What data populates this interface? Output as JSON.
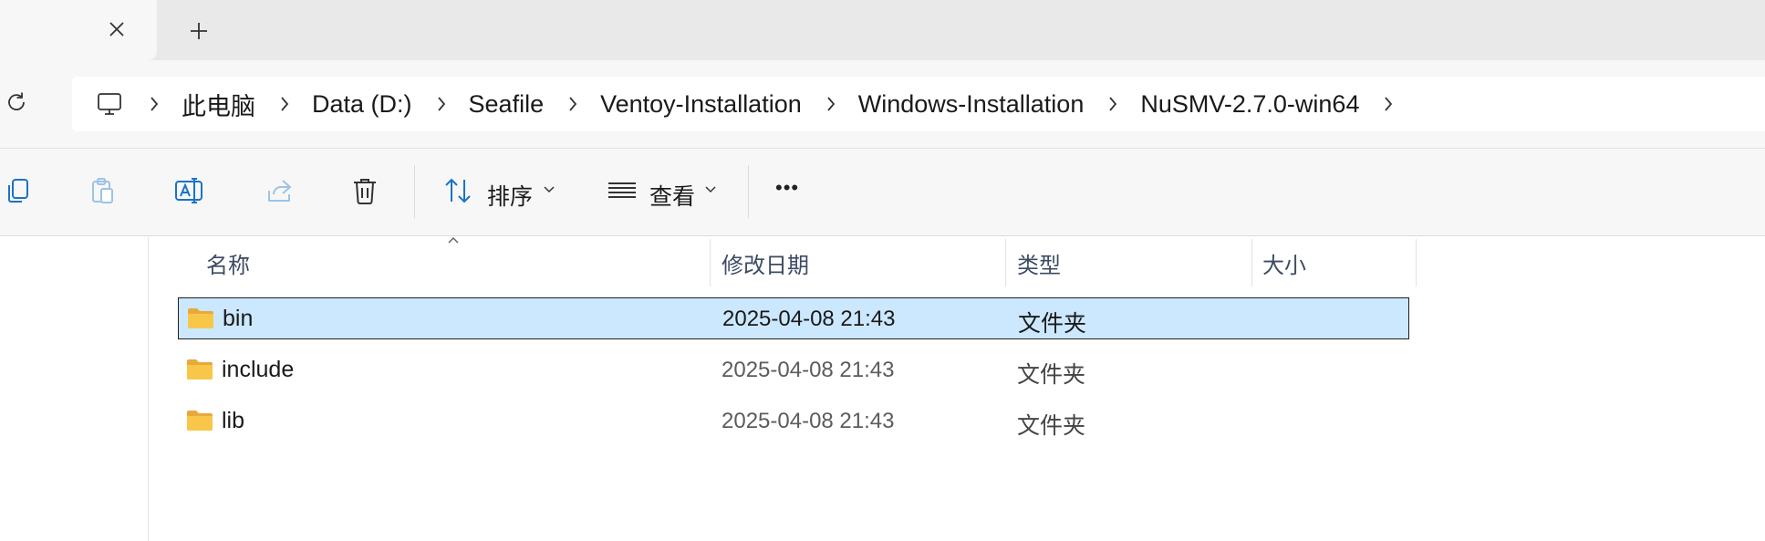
{
  "tabs": {
    "close_icon": "close-icon",
    "new_tab_icon": "plus-icon"
  },
  "address": {
    "refresh_icon": "refresh-icon",
    "root_icon": "this-pc-icon",
    "crumbs": [
      "此电脑",
      "Data (D:)",
      "Seafile",
      "Ventoy-Installation",
      "Windows-Installation",
      "NuSMV-2.7.0-win64"
    ]
  },
  "toolbar": {
    "sort_label": "排序",
    "view_label": "查看",
    "more_label": "•••"
  },
  "columns": {
    "name": "名称",
    "modified": "修改日期",
    "type": "类型",
    "size": "大小"
  },
  "files": [
    {
      "name": "bin",
      "modified": "2025-04-08 21:43",
      "type": "文件夹",
      "size": "",
      "selected": true
    },
    {
      "name": "include",
      "modified": "2025-04-08 21:43",
      "type": "文件夹",
      "size": "",
      "selected": false
    },
    {
      "name": "lib",
      "modified": "2025-04-08 21:43",
      "type": "文件夹",
      "size": "",
      "selected": false
    }
  ],
  "colors": {
    "selection_bg": "#cce8ff",
    "folder_yellow": "#f8c74a",
    "accent_blue": "#1a73c8"
  }
}
